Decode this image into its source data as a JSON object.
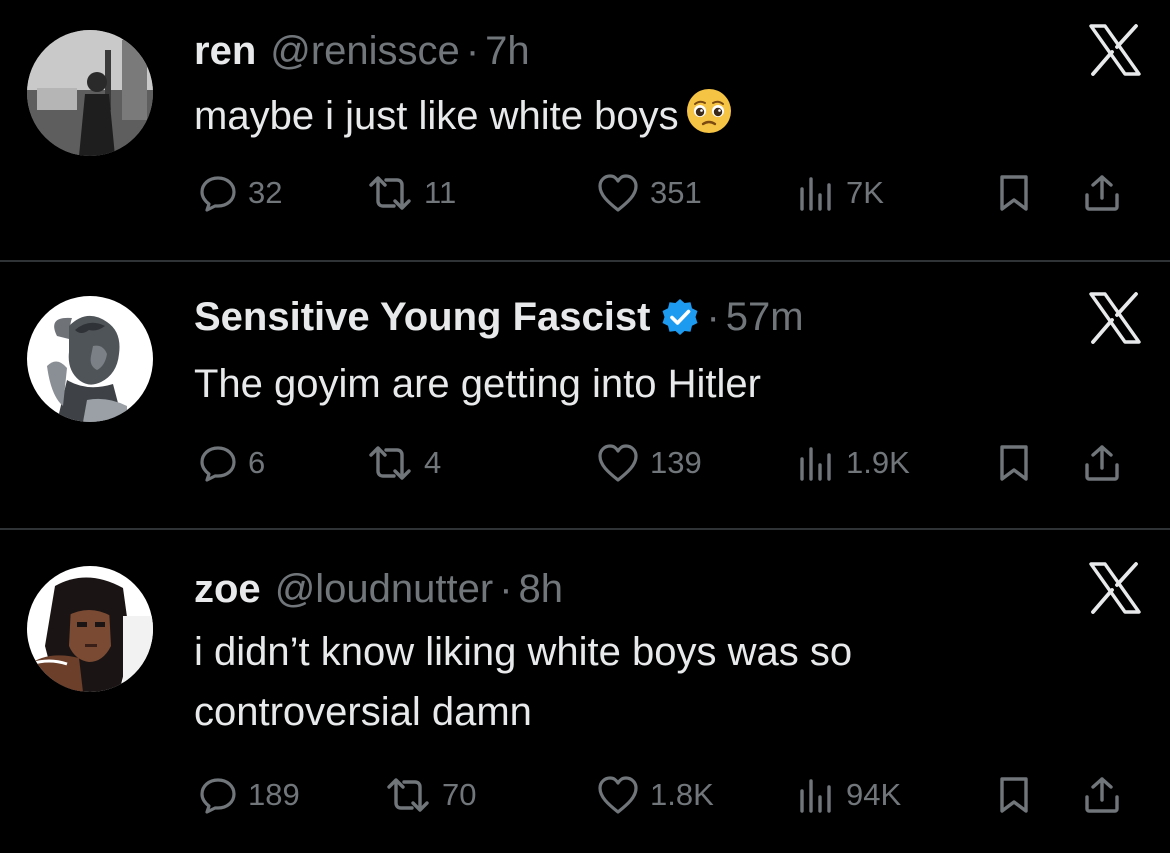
{
  "tweets": [
    {
      "name": "ren",
      "handle": "@renissce",
      "dot": "·",
      "time": "7h",
      "verified": false,
      "text": "maybe i just like white boys",
      "emoji": "pleading-face",
      "replies": "32",
      "reposts": "11",
      "likes": "351",
      "views": "7K"
    },
    {
      "name": "Sensitive Young Fascist",
      "handle": "",
      "dot": "·",
      "time": "57m",
      "verified": true,
      "text": "The goyim are getting into Hitler",
      "replies": "6",
      "reposts": "4",
      "likes": "139",
      "views": "1.9K"
    },
    {
      "name": "zoe",
      "handle": "@loudnutter",
      "dot": "·",
      "time": "8h",
      "verified": false,
      "text": "i didn’t know liking white boys was so\ncontroversial damn",
      "replies": "189",
      "reposts": "70",
      "likes": "1.8K",
      "views": "94K"
    }
  ],
  "colors": {
    "background": "#000000",
    "text": "#e7e9ea",
    "muted": "#71767b",
    "divider": "#2f3336",
    "verified": "#1d9bf0"
  },
  "icons": [
    "reply-icon",
    "repost-icon",
    "like-icon",
    "views-icon",
    "bookmark-icon",
    "share-icon",
    "x-logo-icon",
    "verified-badge-icon"
  ]
}
